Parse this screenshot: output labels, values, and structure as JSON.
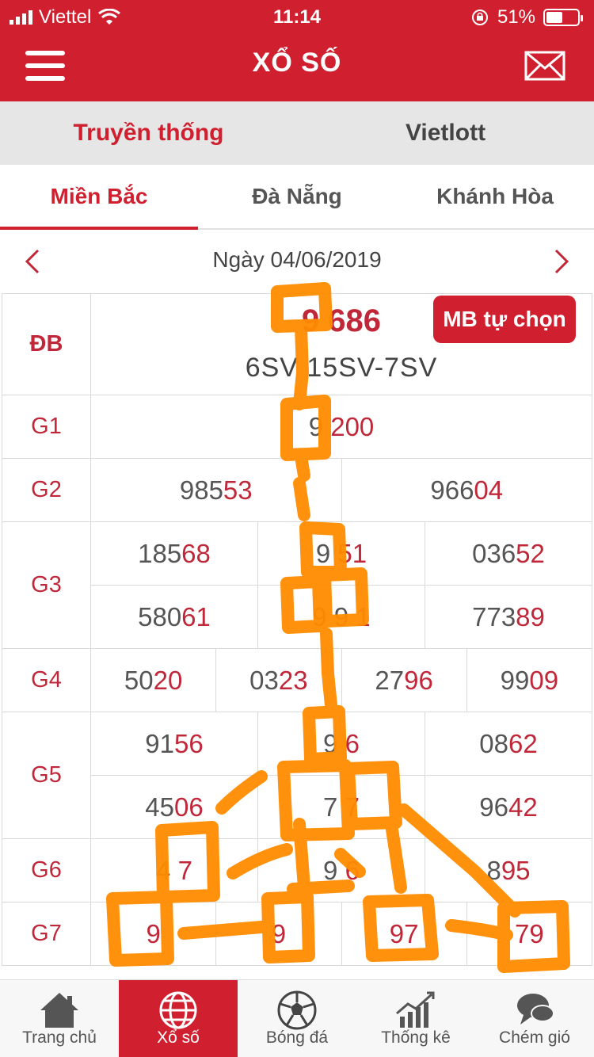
{
  "status_bar": {
    "carrier": "Viettel",
    "time": "11:14",
    "battery": "51%"
  },
  "header": {
    "title": "XỔ SỐ",
    "menu_icon": "hamburger-icon",
    "mail_icon": "envelope-icon"
  },
  "segments": [
    {
      "label": "Truyền thống",
      "active": true
    },
    {
      "label": "Vietlott",
      "active": false
    }
  ],
  "regions": [
    {
      "label": "Miền Bắc",
      "active": true
    },
    {
      "label": "Đà Nẵng"
    },
    {
      "label": "Khánh Hòa"
    }
  ],
  "date": {
    "label": "Ngày 04/06/2019",
    "prev_icon": "chevron-left-icon",
    "next_icon": "chevron-right-icon"
  },
  "results": {
    "db": {
      "label": "ĐB",
      "number": "9 686",
      "code": "6SV 15SV-7SV",
      "button": "MB tự chọn"
    },
    "g1": {
      "label": "G1",
      "numbers": [
        {
          "head": "9",
          "tail": " 200"
        }
      ]
    },
    "g2": {
      "label": "G2",
      "numbers": [
        {
          "head": "985",
          "tail": "53"
        },
        {
          "head": "966",
          "tail": "04"
        }
      ]
    },
    "g3": {
      "label": "G3",
      "rows": [
        [
          {
            "head": "185",
            "tail": "68"
          },
          {
            "head": "9",
            "tail": " 51"
          },
          {
            "head": "036",
            "tail": "52"
          }
        ],
        [
          {
            "head": "580",
            "tail": "61"
          },
          {
            "head": "9 9",
            "tail": " 1"
          },
          {
            "head": "773",
            "tail": "89"
          }
        ]
      ]
    },
    "g4": {
      "label": "G4",
      "numbers": [
        {
          "head": "50",
          "tail": "20"
        },
        {
          "head": "03",
          "tail": "23"
        },
        {
          "head": "27",
          "tail": "96"
        },
        {
          "head": "99",
          "tail": "09"
        }
      ]
    },
    "g5": {
      "label": "G5",
      "rows": [
        [
          {
            "head": "91",
            "tail": "56"
          },
          {
            "head": "9",
            "tail": " 6"
          },
          {
            "head": "08",
            "tail": "62"
          }
        ],
        [
          {
            "head": "45",
            "tail": "06"
          },
          {
            "head": "7",
            "tail": " 7"
          },
          {
            "head": "96",
            "tail": "42"
          }
        ]
      ]
    },
    "g6": {
      "label": "G6",
      "numbers": [
        {
          "head": "4",
          "tail": " 7"
        },
        {
          "head": "9",
          "tail": " 6"
        },
        {
          "head": "8",
          "tail": "95"
        }
      ]
    },
    "g7": {
      "label": "G7",
      "numbers": [
        {
          "head": "",
          "tail": "9"
        },
        {
          "head": "",
          "tail": "9"
        },
        {
          "head": "",
          "tail": "97"
        },
        {
          "head": "",
          "tail": "79"
        }
      ]
    }
  },
  "tabbar": [
    {
      "label": "Trang chủ",
      "icon": "home-icon",
      "active": false
    },
    {
      "label": "Xổ số",
      "icon": "globe-icon",
      "active": true
    },
    {
      "label": "Bóng đá",
      "icon": "soccer-ball-icon",
      "active": false
    },
    {
      "label": "Thống kê",
      "icon": "chart-icon",
      "active": false
    },
    {
      "label": "Chém gió",
      "icon": "chat-icon",
      "active": false
    }
  ],
  "colors": {
    "brand": "#d0202f",
    "number_tail": "#c0283a",
    "overlay": "#ff8c00"
  }
}
